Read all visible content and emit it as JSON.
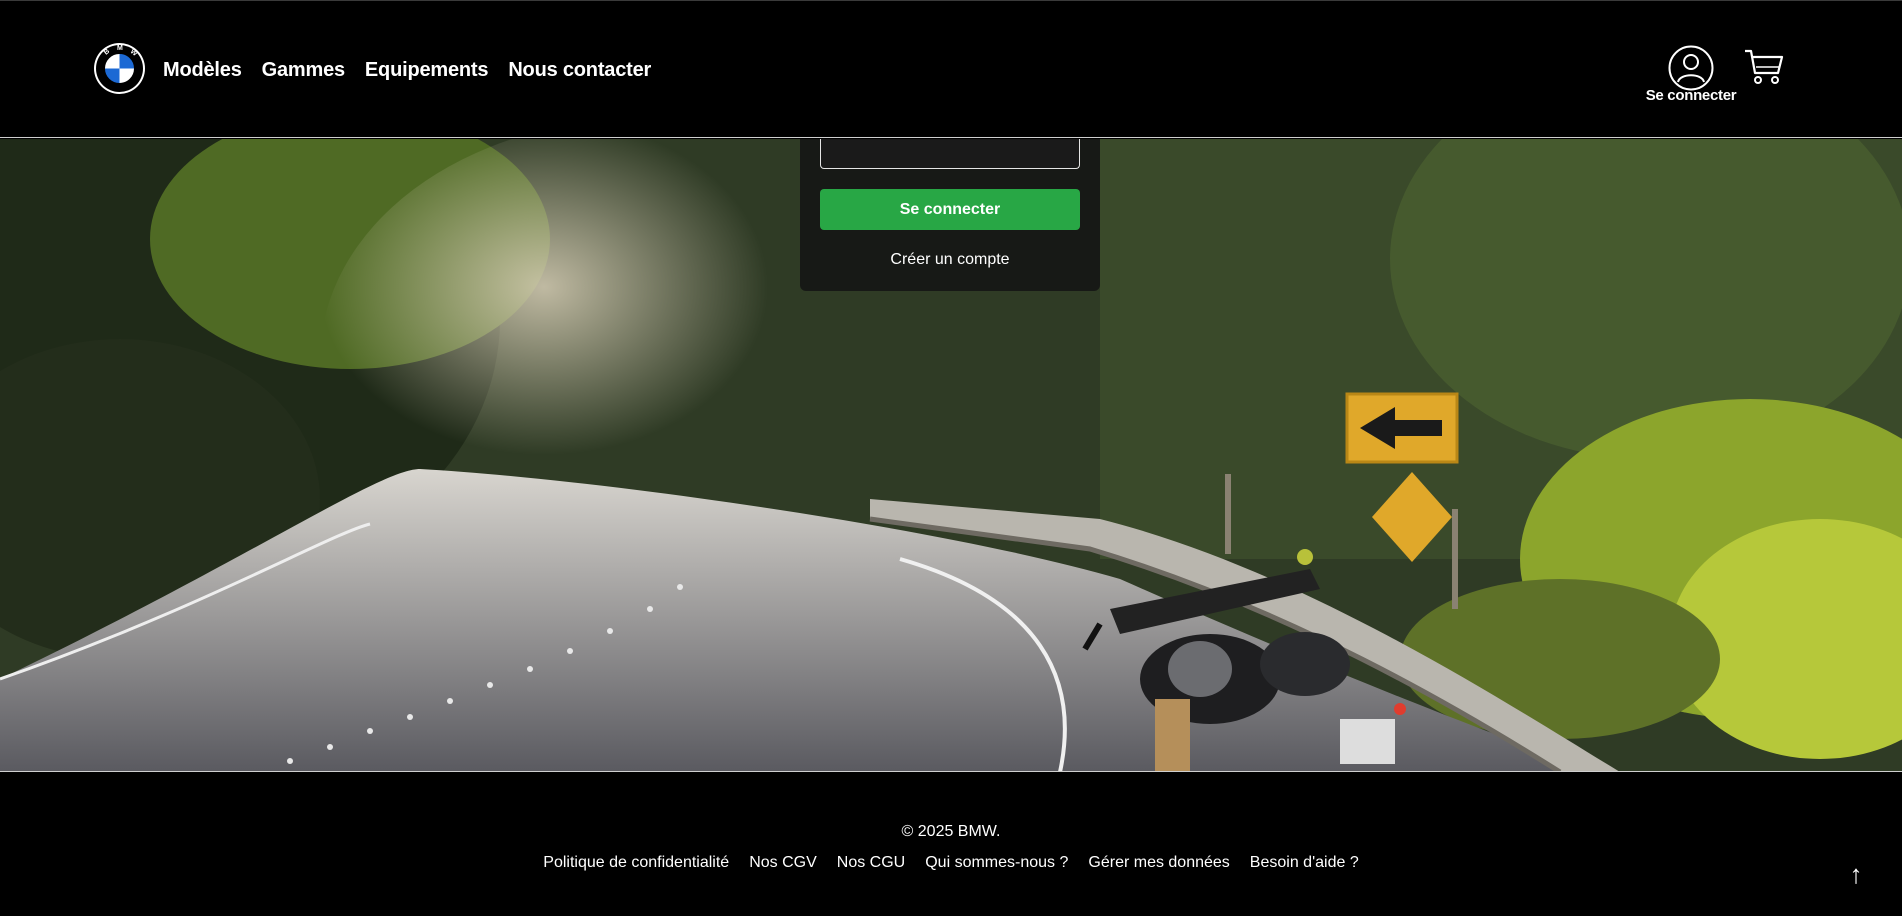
{
  "header": {
    "nav": [
      "Modèles",
      "Gammes",
      "Equipements",
      "Nous contacter"
    ],
    "account_label": "Se connecter",
    "logo_letters": [
      "B",
      "M",
      "W"
    ]
  },
  "login": {
    "submit_label": "Se connecter",
    "create_account": "Créer un compte"
  },
  "footer": {
    "copyright": "© 2025 BMW.",
    "links": [
      "Politique de confidentialité",
      "Nos CGV",
      "Nos CGU",
      "Qui sommes-nous ?",
      "Gérer mes données",
      "Besoin d'aide ?"
    ],
    "back_to_top": "↑"
  },
  "colors": {
    "accent_green": "#28a745",
    "header_bg": "#000000",
    "bmw_blue": "#1c69d4"
  },
  "icons": [
    "bmw-logo-icon",
    "user-icon",
    "cart-icon",
    "arrow-up-icon",
    "arrow-left-sign-icon",
    "diamond-sign-icon",
    "motorcycle-icon"
  ]
}
